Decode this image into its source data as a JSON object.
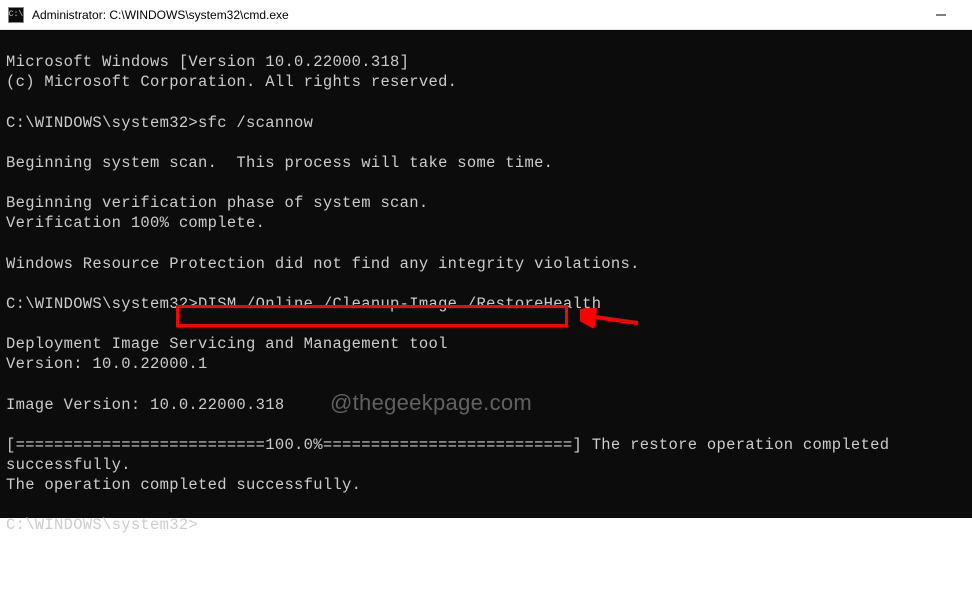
{
  "window": {
    "title": "Administrator: C:\\WINDOWS\\system32\\cmd.exe",
    "icon_label": "C:\\"
  },
  "terminal": {
    "line1": "Microsoft Windows [Version 10.0.22000.318]",
    "line2": "(c) Microsoft Corporation. All rights reserved.",
    "blank1": "",
    "prompt1_path": "C:\\WINDOWS\\system32>",
    "prompt1_cmd": "sfc /scannow",
    "blank2": "",
    "scan_begin": "Beginning system scan.  This process will take some time.",
    "blank3": "",
    "verify_begin": "Beginning verification phase of system scan.",
    "verify_complete": "Verification 100% complete.",
    "blank4": "",
    "no_violations": "Windows Resource Protection did not find any integrity violations.",
    "blank5": "",
    "prompt2_path": "C:\\WINDOWS\\system32>",
    "prompt2_cmd": "DISM /Online /Cleanup-Image /RestoreHealth",
    "blank6": "",
    "dism_tool": "Deployment Image Servicing and Management tool",
    "dism_ver": "Version: 10.0.22000.1",
    "blank7": "",
    "image_ver": "Image Version: 10.0.22000.318",
    "blank8": "",
    "progress": "[==========================100.0%==========================] The restore operation completed successfully.",
    "op_complete": "The operation completed successfully.",
    "blank9": "",
    "prompt3_path": "C:\\WINDOWS\\system32>"
  },
  "watermark": "@thegeekpage.com"
}
